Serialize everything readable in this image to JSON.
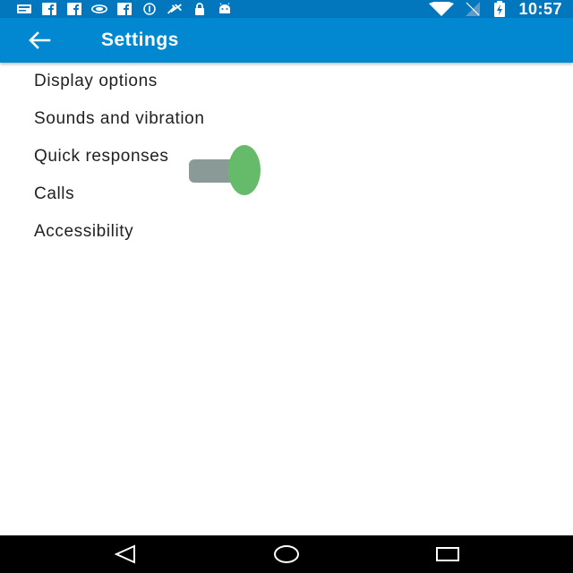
{
  "status_bar": {
    "time": "10:57",
    "left_icons": [
      "notification-icon",
      "facebook-icon",
      "facebook-icon",
      "nvidia-icon",
      "facebook-icon",
      "info-icon",
      "tools-icon",
      "lock-icon",
      "android-icon"
    ],
    "right_icons": [
      "wifi-icon",
      "signal-icon",
      "battery-charging-icon"
    ]
  },
  "app_bar": {
    "title": "Settings",
    "back_icon": "arrow-back-icon",
    "color": "#0288d1"
  },
  "settings": {
    "items": [
      {
        "label": "Display options"
      },
      {
        "label": "Sounds and vibration"
      },
      {
        "label": "Quick responses"
      },
      {
        "label": "Calls"
      },
      {
        "label": "Accessibility"
      }
    ]
  },
  "toggle": {
    "state": "on",
    "thumb_color": "#66bb6a",
    "track_color": "#8a9a97"
  },
  "nav_bar": {
    "buttons": [
      "back-triangle-icon",
      "home-circle-icon",
      "recents-square-icon"
    ]
  }
}
